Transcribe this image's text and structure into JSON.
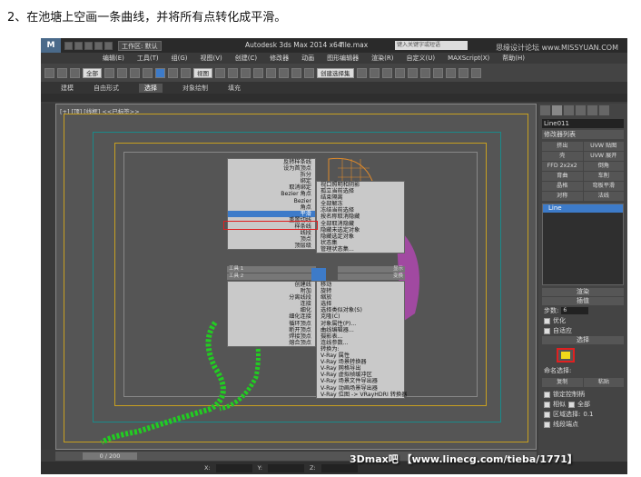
{
  "caption": "2、在池塘上空画一条曲线，并将所有点转化成平滑。",
  "titlebar": {
    "workspace": "工作区: 默认",
    "app_title": "Autodesk 3ds Max  2014 x64",
    "file": "file.max",
    "search_placeholder": "键入关键字或短语",
    "brand": "思缘设计论坛 www.MISSYUAN.COM"
  },
  "menubar": [
    "编辑(E)",
    "工具(T)",
    "组(G)",
    "视图(V)",
    "创建(C)",
    "修改器",
    "动画",
    "图形编辑器",
    "渲染(R)",
    "自定义(U)",
    "MAXScript(X)",
    "帮助(H)"
  ],
  "toolbar": {
    "selection_filter": "全部",
    "view": "视图",
    "named_sets": "创建选择集"
  },
  "ribbon": {
    "tabs": [
      "建模",
      "自由形式",
      "选择",
      "对象绘制",
      "填充"
    ],
    "active": "选择"
  },
  "viewport": {
    "label": "[+] [顶] [线框]  <<已标签>>"
  },
  "quad_left_top": [
    "反转样条线",
    "设为首顶点",
    "拆分",
    "绑定",
    "取消绑定",
    "Bezier 角点",
    "Bezier",
    "角点",
    "平滑",
    "重置切线",
    "样条线",
    "线段",
    "顶点",
    "顶层级"
  ],
  "quad_right_top": [
    "视口照明和阴影",
    "孤立当前选择",
    "结束隔离",
    "全部解冻",
    "冻结当前选择",
    "按名称取消隐藏",
    "全部取消隐藏",
    "隐藏未选定对象",
    "隐藏选定对象",
    "状态集",
    "管理状态集..."
  ],
  "quad_labels": {
    "tools1": "工具 1",
    "tools2": "工具 2",
    "display": "显示",
    "transform": "变换"
  },
  "quad_left_bottom": [
    "创建线",
    "附加",
    "分离线段",
    "连接",
    "细化",
    "细化连接",
    "循环顶点",
    "断开顶点",
    "焊接顶点",
    "熔合顶点"
  ],
  "quad_right_bottom": [
    "移动",
    "旋转",
    "缩放",
    "选择",
    "选择类似对象(S)",
    "克隆(C)",
    "对象属性(P)...",
    "曲线编辑器...",
    "摄影表...",
    "连线参数...",
    "转换为:",
    "V-Ray 属性",
    "V-Ray 场景转换器",
    "V-Ray 网格导出",
    "V-Ray 虚拟帧缓冲区",
    "V-Ray 场景文件导出器",
    "V-Ray 动画场景导出器",
    "V-Ray 位图 -> VRayHDRI 转换器"
  ],
  "command_panel": {
    "object_name": "Line011",
    "modifier_list": "修改器列表",
    "buttons": [
      "挤出",
      "UVW 贴图",
      "壳",
      "UVW 展开",
      "FFD 2x2x2",
      "倒角",
      "育曲",
      "车削",
      "晶格",
      "弯板平滑",
      "对称",
      "法线"
    ],
    "stack_item": "Line",
    "rollouts": {
      "render": "渲染",
      "interpolation": "插值",
      "selection": "选择"
    },
    "steps_label": "步数:",
    "steps_value": "6",
    "optimize": "优化",
    "adaptive": "自适应",
    "named_selection": "命名选择:",
    "copy": "复制",
    "paste": "粘贴",
    "lock_handles": "锁定控制柄",
    "similar": "相似",
    "all": "全部",
    "area_select": "区域选择:",
    "area_value": "0.1",
    "segment_end": "线段端点"
  },
  "timeline": {
    "range": "0 / 200"
  },
  "status": {
    "x_label": "X:",
    "y_label": "Y:",
    "z_label": "Z:"
  },
  "watermark": "3Dmax吧 【www.linecg.com/tieba/1771】",
  "colors": {
    "highlight": "#3d7bc9",
    "accent_red": "#e02020",
    "curve_green": "#22cc22",
    "pond_orange": "#e08a2a",
    "pond_pink": "#e040e0"
  }
}
